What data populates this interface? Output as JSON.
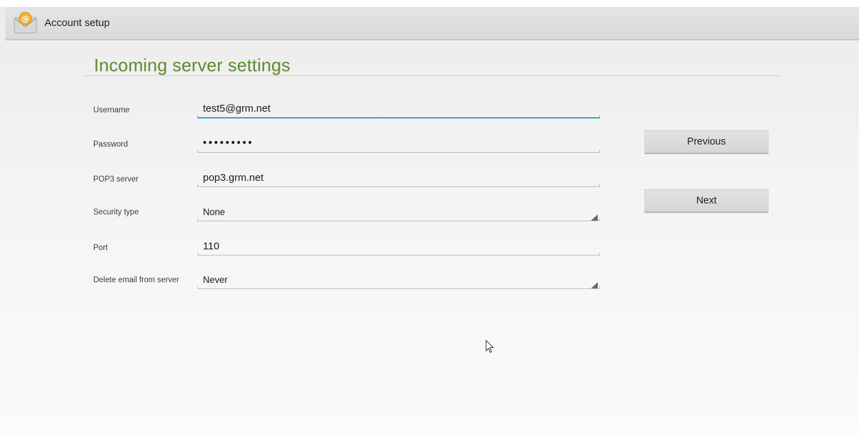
{
  "action_bar": {
    "title": "Account setup",
    "app_icon": "email-app-icon"
  },
  "page": {
    "title": "Incoming server settings"
  },
  "form": {
    "username": {
      "label": "Username",
      "value": "test5@grm.net"
    },
    "password": {
      "label": "Password",
      "value": "•••••••••"
    },
    "pop3_server": {
      "label": "POP3 server",
      "value": "pop3.grm.net"
    },
    "security_type": {
      "label": "Security type",
      "value": "None"
    },
    "port": {
      "label": "Port",
      "value": "110"
    },
    "delete_email": {
      "label": "Delete email from server",
      "value": "Never"
    }
  },
  "buttons": {
    "previous": "Previous",
    "next": "Next"
  },
  "colors": {
    "accent_title": "#5c8a2f",
    "focus_underline": "#33a6cc"
  }
}
